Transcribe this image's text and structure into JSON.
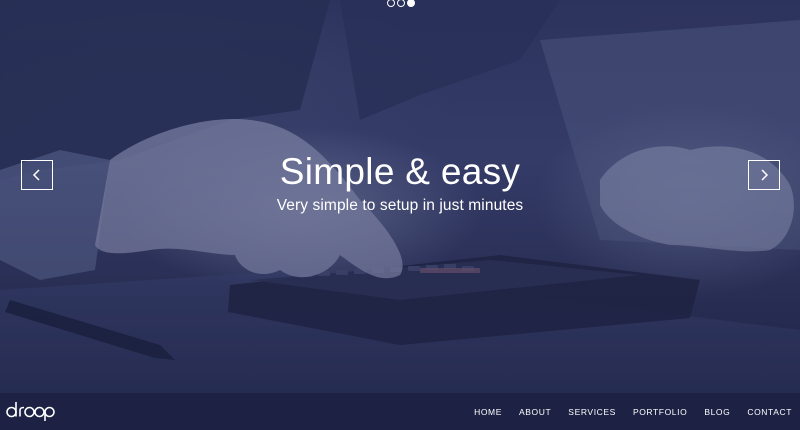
{
  "slider": {
    "slide_count": 3,
    "active_slide_index": 3,
    "title": "Simple & easy",
    "subtitle": "Very simple to setup in just minutes",
    "prev_icon": "chevron-left-icon",
    "next_icon": "chevron-right-icon"
  },
  "brand": {
    "logo_text": "droop"
  },
  "nav": {
    "items": [
      {
        "label": "HOME"
      },
      {
        "label": "ABOUT"
      },
      {
        "label": "SERVICES"
      },
      {
        "label": "PORTFOLIO"
      },
      {
        "label": "BLOG"
      },
      {
        "label": "CONTACT"
      }
    ]
  },
  "colors": {
    "navbar_bg": "#1d2244",
    "overlay_tint": "#2f3660",
    "text": "#ffffff"
  }
}
